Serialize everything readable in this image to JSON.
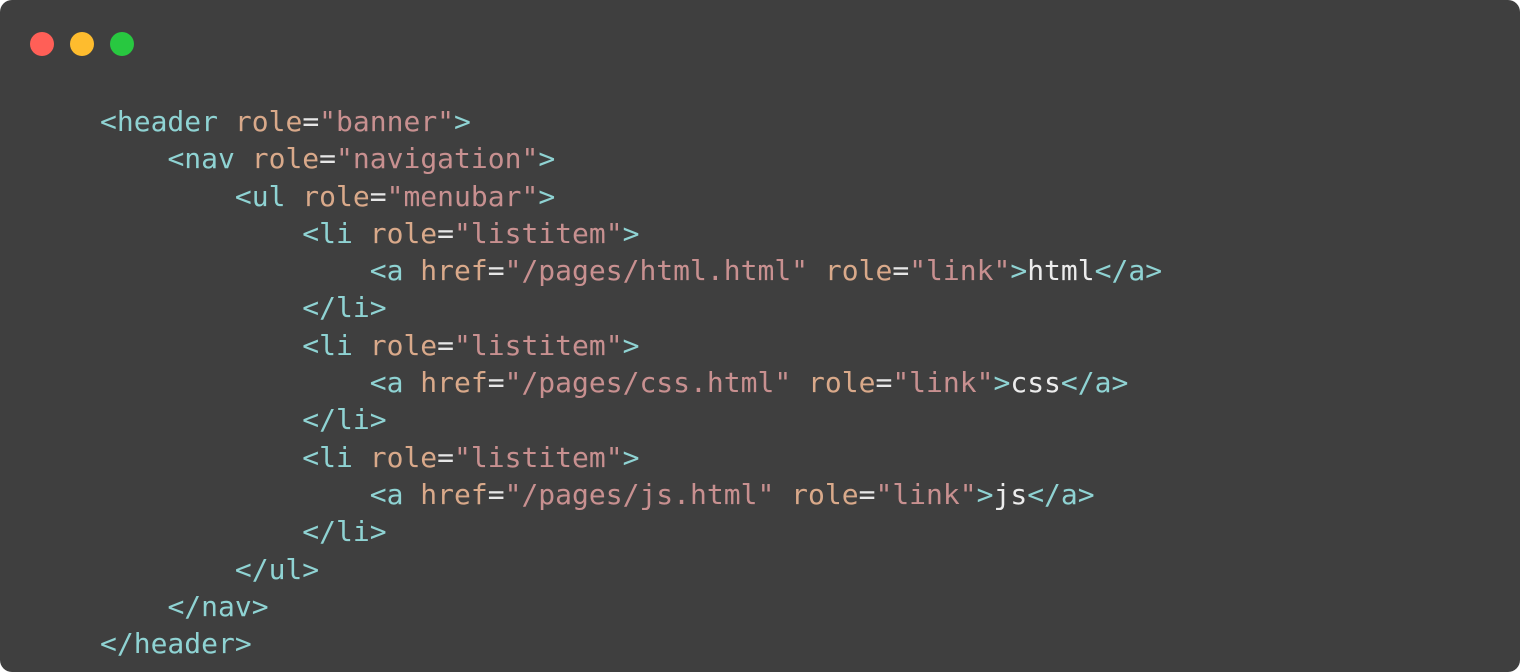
{
  "window": {
    "colors": {
      "background": "#3f3f3f",
      "close": "#ff5f57",
      "minimize": "#febc2e",
      "maximize": "#28c840",
      "tag": "#8fd3d3",
      "attr": "#d9a98a",
      "string": "#c89090",
      "text": "#ececec"
    }
  },
  "code": {
    "lines": [
      {
        "indent": 0,
        "tokens": [
          {
            "t": "punct",
            "v": "<"
          },
          {
            "t": "tag",
            "v": "header"
          },
          {
            "t": "sp",
            "v": " "
          },
          {
            "t": "attr",
            "v": "role"
          },
          {
            "t": "eq",
            "v": "="
          },
          {
            "t": "str",
            "v": "\"banner\""
          },
          {
            "t": "punct",
            "v": ">"
          }
        ]
      },
      {
        "indent": 1,
        "tokens": [
          {
            "t": "punct",
            "v": "<"
          },
          {
            "t": "tag",
            "v": "nav"
          },
          {
            "t": "sp",
            "v": " "
          },
          {
            "t": "attr",
            "v": "role"
          },
          {
            "t": "eq",
            "v": "="
          },
          {
            "t": "str",
            "v": "\"navigation\""
          },
          {
            "t": "punct",
            "v": ">"
          }
        ]
      },
      {
        "indent": 2,
        "tokens": [
          {
            "t": "punct",
            "v": "<"
          },
          {
            "t": "tag",
            "v": "ul"
          },
          {
            "t": "sp",
            "v": " "
          },
          {
            "t": "attr",
            "v": "role"
          },
          {
            "t": "eq",
            "v": "="
          },
          {
            "t": "str",
            "v": "\"menubar\""
          },
          {
            "t": "punct",
            "v": ">"
          }
        ]
      },
      {
        "indent": 3,
        "tokens": [
          {
            "t": "punct",
            "v": "<"
          },
          {
            "t": "tag",
            "v": "li"
          },
          {
            "t": "sp",
            "v": " "
          },
          {
            "t": "attr",
            "v": "role"
          },
          {
            "t": "eq",
            "v": "="
          },
          {
            "t": "str",
            "v": "\"listitem\""
          },
          {
            "t": "punct",
            "v": ">"
          }
        ]
      },
      {
        "indent": 4,
        "tokens": [
          {
            "t": "punct",
            "v": "<"
          },
          {
            "t": "tag",
            "v": "a"
          },
          {
            "t": "sp",
            "v": " "
          },
          {
            "t": "attr",
            "v": "href"
          },
          {
            "t": "eq",
            "v": "="
          },
          {
            "t": "str",
            "v": "\"/pages/html.html\""
          },
          {
            "t": "sp",
            "v": " "
          },
          {
            "t": "attr",
            "v": "role"
          },
          {
            "t": "eq",
            "v": "="
          },
          {
            "t": "str",
            "v": "\"link\""
          },
          {
            "t": "punct",
            "v": ">"
          },
          {
            "t": "text",
            "v": "html"
          },
          {
            "t": "punct",
            "v": "</"
          },
          {
            "t": "tag",
            "v": "a"
          },
          {
            "t": "punct",
            "v": ">"
          }
        ]
      },
      {
        "indent": 3,
        "tokens": [
          {
            "t": "punct",
            "v": "</"
          },
          {
            "t": "tag",
            "v": "li"
          },
          {
            "t": "punct",
            "v": ">"
          }
        ]
      },
      {
        "indent": 3,
        "tokens": [
          {
            "t": "punct",
            "v": "<"
          },
          {
            "t": "tag",
            "v": "li"
          },
          {
            "t": "sp",
            "v": " "
          },
          {
            "t": "attr",
            "v": "role"
          },
          {
            "t": "eq",
            "v": "="
          },
          {
            "t": "str",
            "v": "\"listitem\""
          },
          {
            "t": "punct",
            "v": ">"
          }
        ]
      },
      {
        "indent": 4,
        "tokens": [
          {
            "t": "punct",
            "v": "<"
          },
          {
            "t": "tag",
            "v": "a"
          },
          {
            "t": "sp",
            "v": " "
          },
          {
            "t": "attr",
            "v": "href"
          },
          {
            "t": "eq",
            "v": "="
          },
          {
            "t": "str",
            "v": "\"/pages/css.html\""
          },
          {
            "t": "sp",
            "v": " "
          },
          {
            "t": "attr",
            "v": "role"
          },
          {
            "t": "eq",
            "v": "="
          },
          {
            "t": "str",
            "v": "\"link\""
          },
          {
            "t": "punct",
            "v": ">"
          },
          {
            "t": "text",
            "v": "css"
          },
          {
            "t": "punct",
            "v": "</"
          },
          {
            "t": "tag",
            "v": "a"
          },
          {
            "t": "punct",
            "v": ">"
          }
        ]
      },
      {
        "indent": 3,
        "tokens": [
          {
            "t": "punct",
            "v": "</"
          },
          {
            "t": "tag",
            "v": "li"
          },
          {
            "t": "punct",
            "v": ">"
          }
        ]
      },
      {
        "indent": 3,
        "tokens": [
          {
            "t": "punct",
            "v": "<"
          },
          {
            "t": "tag",
            "v": "li"
          },
          {
            "t": "sp",
            "v": " "
          },
          {
            "t": "attr",
            "v": "role"
          },
          {
            "t": "eq",
            "v": "="
          },
          {
            "t": "str",
            "v": "\"listitem\""
          },
          {
            "t": "punct",
            "v": ">"
          }
        ]
      },
      {
        "indent": 4,
        "tokens": [
          {
            "t": "punct",
            "v": "<"
          },
          {
            "t": "tag",
            "v": "a"
          },
          {
            "t": "sp",
            "v": " "
          },
          {
            "t": "attr",
            "v": "href"
          },
          {
            "t": "eq",
            "v": "="
          },
          {
            "t": "str",
            "v": "\"/pages/js.html\""
          },
          {
            "t": "sp",
            "v": " "
          },
          {
            "t": "attr",
            "v": "role"
          },
          {
            "t": "eq",
            "v": "="
          },
          {
            "t": "str",
            "v": "\"link\""
          },
          {
            "t": "punct",
            "v": ">"
          },
          {
            "t": "text",
            "v": "js"
          },
          {
            "t": "punct",
            "v": "</"
          },
          {
            "t": "tag",
            "v": "a"
          },
          {
            "t": "punct",
            "v": ">"
          }
        ]
      },
      {
        "indent": 3,
        "tokens": [
          {
            "t": "punct",
            "v": "</"
          },
          {
            "t": "tag",
            "v": "li"
          },
          {
            "t": "punct",
            "v": ">"
          }
        ]
      },
      {
        "indent": 2,
        "tokens": [
          {
            "t": "punct",
            "v": "</"
          },
          {
            "t": "tag",
            "v": "ul"
          },
          {
            "t": "punct",
            "v": ">"
          }
        ]
      },
      {
        "indent": 1,
        "tokens": [
          {
            "t": "punct",
            "v": "</"
          },
          {
            "t": "tag",
            "v": "nav"
          },
          {
            "t": "punct",
            "v": ">"
          }
        ]
      },
      {
        "indent": 0,
        "tokens": [
          {
            "t": "punct",
            "v": "</"
          },
          {
            "t": "tag",
            "v": "header"
          },
          {
            "t": "punct",
            "v": ">"
          }
        ]
      }
    ]
  }
}
